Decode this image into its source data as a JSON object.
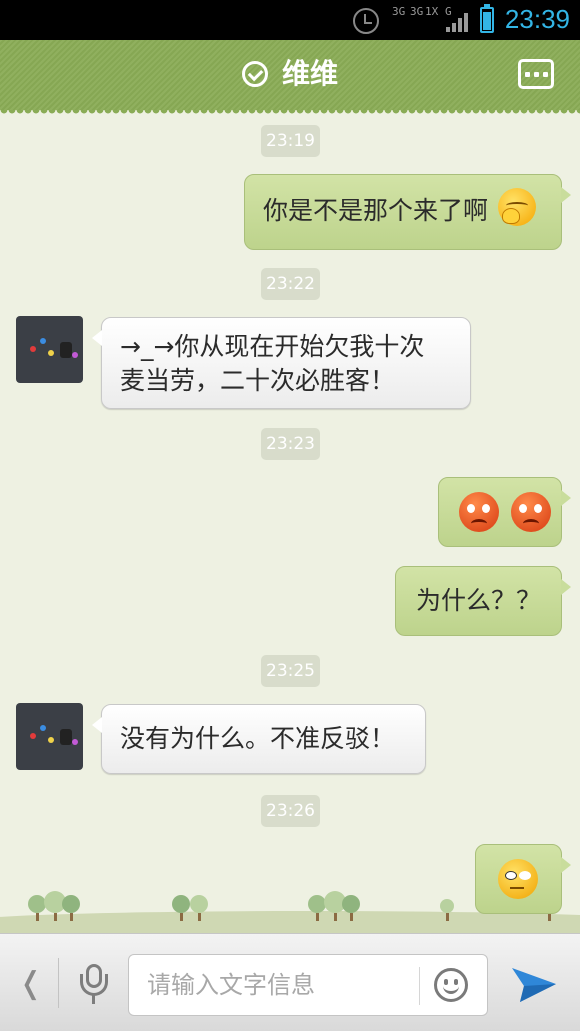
{
  "status_bar": {
    "net_label_1": "3G",
    "net_label_2": "3G",
    "net_label_3": "1X",
    "net_label_4": "G",
    "time": "23:39",
    "icons": [
      "alarm-icon",
      "signal-icon",
      "battery-icon"
    ],
    "accent_color": "#33b5e5"
  },
  "header": {
    "title": "维维",
    "verified_icon": "check-circle-icon",
    "menu_icon": "more-options-icon",
    "background_color": "#8aac56"
  },
  "chat": {
    "ts1": "23:19",
    "m1": "你是不是那个来了啊",
    "m1_emoji": "shy-emoji",
    "ts2": "23:22",
    "m2": "→_→你从现在开始欠我十次\n麦当劳，二十次必胜客！",
    "ts3": "23:23",
    "m3_emoji": "angry-emoji",
    "m4": "为什么？？",
    "ts4": "23:25",
    "m5": "没有为什么。不准反驳！",
    "ts5": "23:26",
    "m6_emoji": "eye-roll-emoji",
    "out_bubble_color": "#c9dd9c",
    "in_bubble_color": "#ffffff"
  },
  "input_bar": {
    "back_glyph": "❬",
    "placeholder": "请输入文字信息",
    "value": "",
    "icons": [
      "chevron-left-icon",
      "microphone-icon",
      "smiley-icon",
      "send-icon"
    ]
  }
}
